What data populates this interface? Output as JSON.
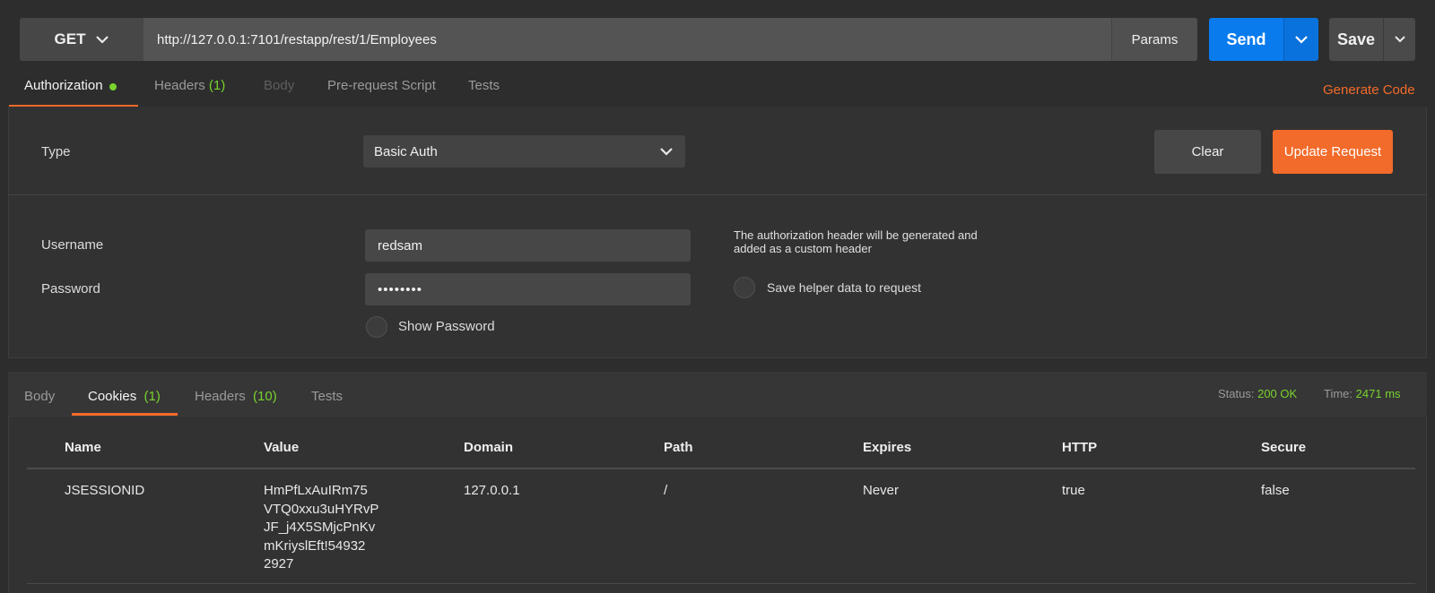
{
  "request": {
    "method": "GET",
    "url": "http://127.0.0.1:7101/restapp/rest/1/Employees",
    "params_label": "Params",
    "send_label": "Send",
    "save_label": "Save"
  },
  "request_tabs": [
    {
      "label": "Authorization",
      "active": true
    },
    {
      "label": "Headers",
      "count": "(1)"
    },
    {
      "label": "Body",
      "disabled": true
    },
    {
      "label": "Pre-request Script"
    },
    {
      "label": "Tests"
    }
  ],
  "generate_code_label": "Generate Code",
  "auth": {
    "type_label": "Type",
    "type_value": "Basic Auth",
    "clear_label": "Clear",
    "update_label": "Update Request",
    "username_label": "Username",
    "username_value": "redsam",
    "password_label": "Password",
    "password_value": "••••••••",
    "show_password_label": "Show Password",
    "info_text": "The authorization header will be generated and added as a custom header",
    "save_helper_label": "Save helper data to request"
  },
  "response": {
    "tabs": [
      {
        "label": "Body"
      },
      {
        "label": "Cookies",
        "count": "(1)",
        "active": true
      },
      {
        "label": "Headers",
        "count": "(10)"
      },
      {
        "label": "Tests"
      }
    ],
    "status_label": "Status:",
    "status_value": "200 OK",
    "time_label": "Time:",
    "time_value": "2471 ms",
    "columns": [
      "Name",
      "Value",
      "Domain",
      "Path",
      "Expires",
      "HTTP",
      "Secure"
    ],
    "rows": [
      {
        "name": "JSESSIONID",
        "value_lines": [
          "HmPfLxAuIRm75",
          "VTQ0xxu3uHYRvP",
          "JF_j4X5SMjcPnKv",
          "mKriyslEft!54932",
          "2927"
        ],
        "domain": "127.0.0.1",
        "path": "/",
        "expires": "Never",
        "http": "true",
        "secure": "false"
      }
    ]
  },
  "colors": {
    "accent_orange": "#f26b2a",
    "send_blue": "#097bed",
    "status_green": "#79d32e"
  }
}
